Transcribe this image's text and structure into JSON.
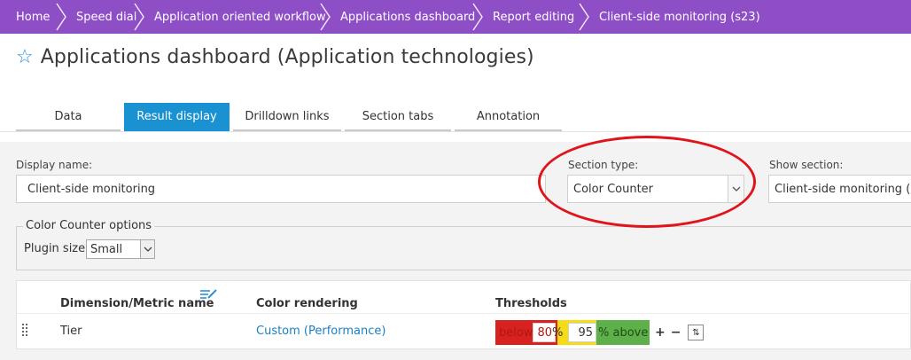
{
  "breadcrumb": [
    {
      "label": "Home"
    },
    {
      "label": "Speed dial"
    },
    {
      "label": "Application oriented workflow"
    },
    {
      "label": "Applications dashboard"
    },
    {
      "label": "Report editing"
    },
    {
      "label": "Client-side monitoring (s23)"
    }
  ],
  "page": {
    "title": "Applications dashboard (Application technologies)",
    "star_icon": "☆"
  },
  "tabs": [
    {
      "label": "Data",
      "active": false
    },
    {
      "label": "Result display",
      "active": true
    },
    {
      "label": "Drilldown links",
      "active": false
    },
    {
      "label": "Section tabs",
      "active": false
    },
    {
      "label": "Annotation",
      "active": false
    }
  ],
  "form": {
    "display_name_label": "Display name:",
    "display_name_value": "Client-side monitoring",
    "section_type_label": "Section type:",
    "section_type_value": "Color Counter",
    "show_section_label": "Show section:",
    "show_section_value": "Client-side monitoring (s"
  },
  "options": {
    "legend": "Color Counter options",
    "plugin_size_label": "Plugin size",
    "plugin_size_value": "Small"
  },
  "table": {
    "headers": {
      "name": "Dimension/Metric name",
      "rendering": "Color rendering",
      "thresholds": "Thresholds"
    },
    "rows": [
      {
        "name": "Tier",
        "rendering": "Custom (Performance)",
        "below_label": "below",
        "low_value": "80",
        "low_unit": "%",
        "high_value": "95",
        "high_unit": "% above",
        "plus": "+",
        "minus": "−",
        "sort_glyph": "⇅"
      }
    ]
  },
  "colors": {
    "breadcrumb_bg": "#8e4ec6",
    "active_tab": "#1a91d1",
    "threshold_red": "#d8221f",
    "threshold_yellow": "#f5dc16",
    "threshold_green": "#5eb14a",
    "annotation": "#e0151b"
  }
}
